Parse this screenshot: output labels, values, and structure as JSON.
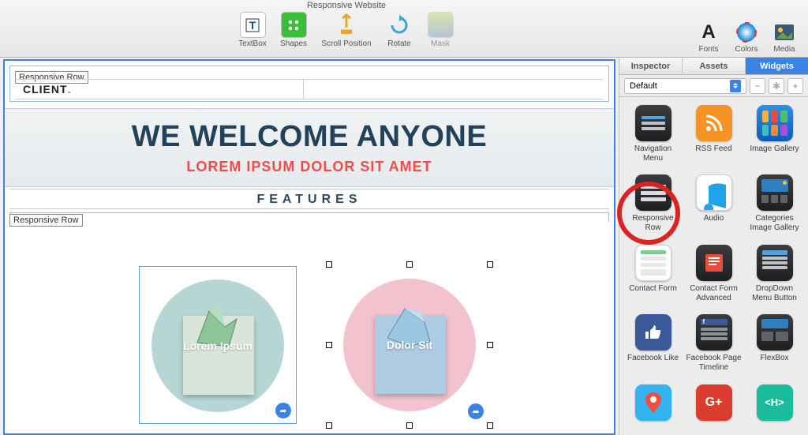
{
  "window": {
    "title": "Responsive Website"
  },
  "toolbar": {
    "items": [
      {
        "label": "TextBox"
      },
      {
        "label": "Shapes"
      },
      {
        "label": "Scroll Position"
      },
      {
        "label": "Rotate"
      },
      {
        "label": "Mask"
      }
    ],
    "right": [
      {
        "label": "Fonts"
      },
      {
        "label": "Colors"
      },
      {
        "label": "Media"
      }
    ]
  },
  "canvas": {
    "responsive_row_label": "Responsive Row",
    "brand_main": "CLIENT",
    "brand_dot": ".",
    "hero_title": "WE WELCOME ANYONE",
    "hero_sub": "LOREM IPSUM DOLOR SIT AMET",
    "features": "FEATURES",
    "card1": "Lorem Ipsum",
    "card2": "Dolor Sit"
  },
  "sidebar": {
    "tabs": [
      "Inspector",
      "Assets",
      "Widgets"
    ],
    "active_tab": 2,
    "category_select": "Default",
    "widgets": [
      {
        "label": "Navigation Menu"
      },
      {
        "label": "RSS Feed"
      },
      {
        "label": "Image Gallery"
      },
      {
        "label": "Responsive Row"
      },
      {
        "label": "Audio"
      },
      {
        "label": "Categories Image Gallery"
      },
      {
        "label": "Contact Form"
      },
      {
        "label": "Contact Form Advanced"
      },
      {
        "label": "DropDown Menu Button"
      },
      {
        "label": "Facebook Like"
      },
      {
        "label": "Facebook Page Timeline"
      },
      {
        "label": "FlexBox"
      }
    ],
    "highlighted_index": 3
  }
}
